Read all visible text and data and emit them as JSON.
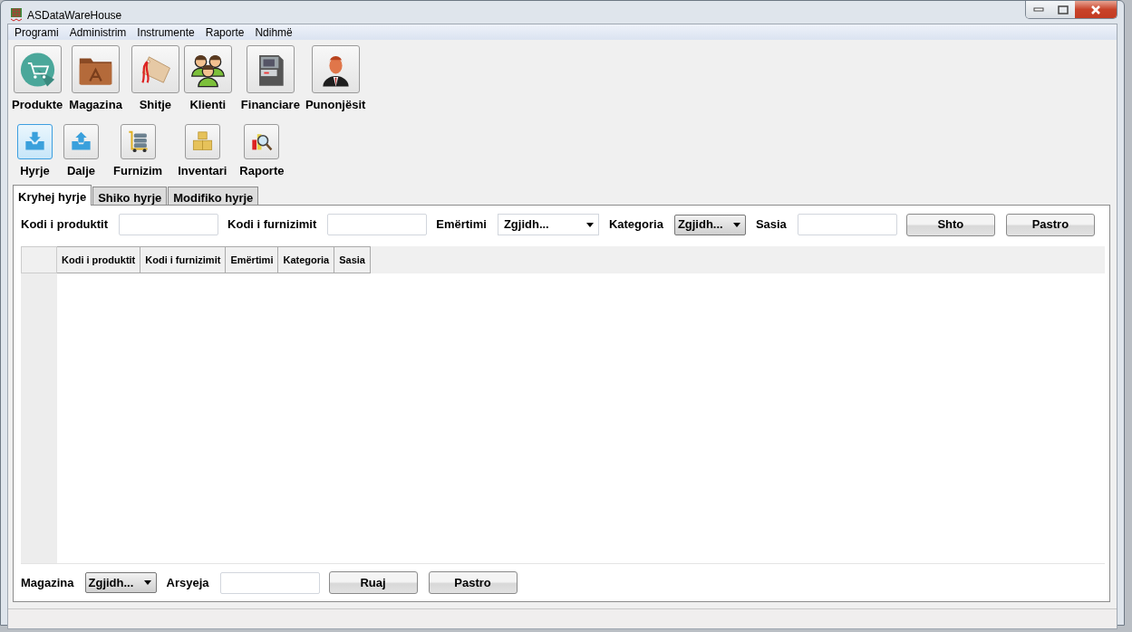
{
  "window": {
    "title": "ASDataWareHouse"
  },
  "menu": [
    "Programi",
    "Administrim",
    "Instrumente",
    "Raporte",
    "Ndihmë"
  ],
  "modules": [
    {
      "label": "Produkte"
    },
    {
      "label": "Magazina"
    },
    {
      "label": "Shitje"
    },
    {
      "label": "Klienti"
    },
    {
      "label": "Financiare"
    },
    {
      "label": "Punonjësit"
    }
  ],
  "actions": [
    {
      "label": "Hyrje",
      "selected": true
    },
    {
      "label": "Dalje",
      "selected": false
    },
    {
      "label": "Furnizim",
      "selected": false
    },
    {
      "label": "Inventari",
      "selected": false
    },
    {
      "label": "Raporte",
      "selected": false
    }
  ],
  "tabs": [
    {
      "label": "Kryhej hyrje",
      "selected": true
    },
    {
      "label": "Shiko hyrje",
      "selected": false
    },
    {
      "label": "Modifiko hyrje",
      "selected": false
    }
  ],
  "entry_form": [
    {
      "kind": "input",
      "label": "Kodi i produktit"
    },
    {
      "kind": "input",
      "label": "Kodi i furnizimit"
    },
    {
      "kind": "combo-flat",
      "label": "Emërtimi",
      "value": "Zgjidh..."
    },
    {
      "kind": "combo-raised",
      "label": "Kategoria",
      "value": "Zgjidh..."
    },
    {
      "kind": "input",
      "label": "Sasia"
    }
  ],
  "entry_buttons": [
    "Shto",
    "Pastro"
  ],
  "table": {
    "columns": [
      "Kodi i produktit",
      "Kodi i furnizimit",
      "Emërtimi",
      "Kategoria",
      "Sasia"
    ]
  },
  "footer_form": [
    {
      "kind": "combo-raised",
      "label": "Magazina",
      "value": "Zgjidh..."
    },
    {
      "kind": "input",
      "label": "Arsyeja"
    }
  ],
  "footer_buttons": [
    "Ruaj",
    "Pastro"
  ]
}
